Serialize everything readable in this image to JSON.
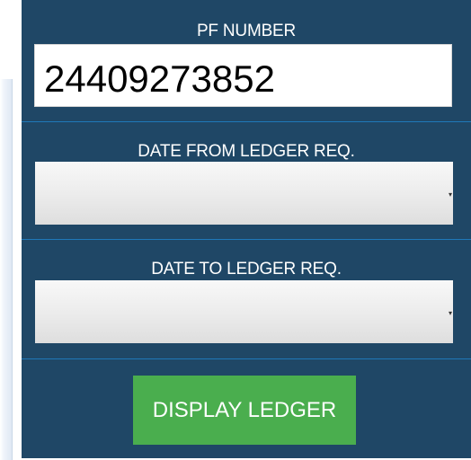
{
  "form": {
    "pf_number": {
      "label": "PF NUMBER",
      "value": "24409273852"
    },
    "date_from": {
      "label": "DATE FROM LEDGER REQ.",
      "selected": ""
    },
    "date_to": {
      "label": "DATE TO LEDGER REQ.",
      "selected": ""
    },
    "submit_label": "DISPLAY LEDGER"
  },
  "colors": {
    "panel_bg": "#1f4766",
    "divider": "#1f78b9",
    "button_bg": "#4aae4e",
    "label_text": "#ffffff"
  },
  "icons": {
    "dropdown": "dropdown-arrow-icon"
  }
}
